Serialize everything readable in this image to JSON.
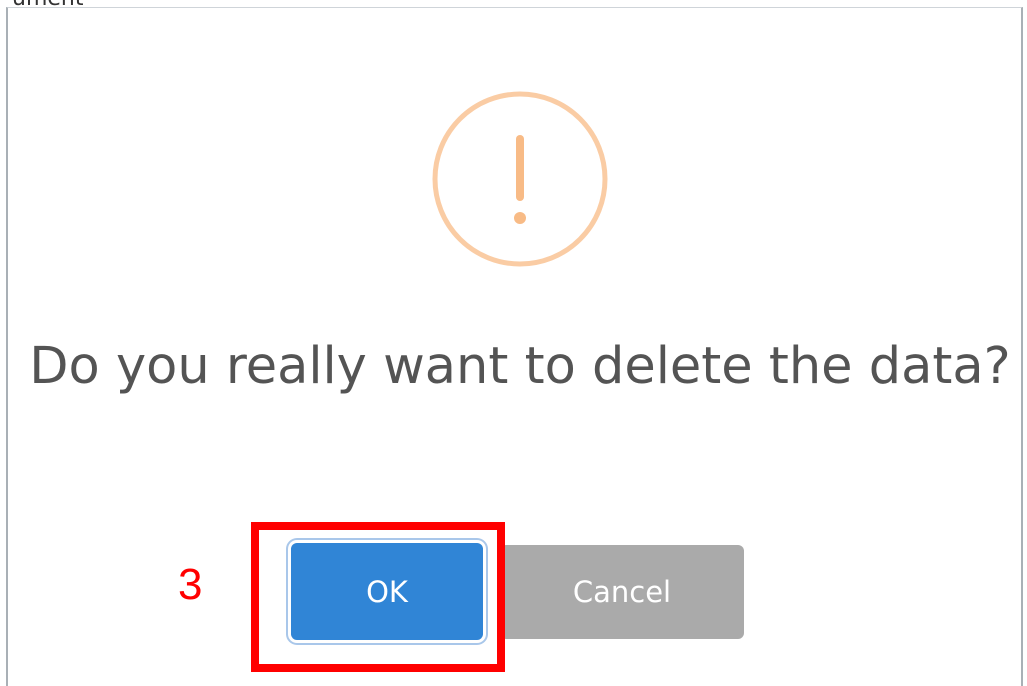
{
  "background": {
    "partial_text": "ument"
  },
  "dialog": {
    "icon": "warning-exclamation-icon",
    "message": "Do you really want to delete the data?",
    "ok_label": "OK",
    "cancel_label": "Cancel"
  },
  "annotation": {
    "step_number": "3"
  },
  "colors": {
    "ok_button": "#3085d6",
    "cancel_button": "#aaaaaa",
    "warning_icon": "#f8bb86",
    "highlight": "#ff0000",
    "message_text": "#545454"
  }
}
